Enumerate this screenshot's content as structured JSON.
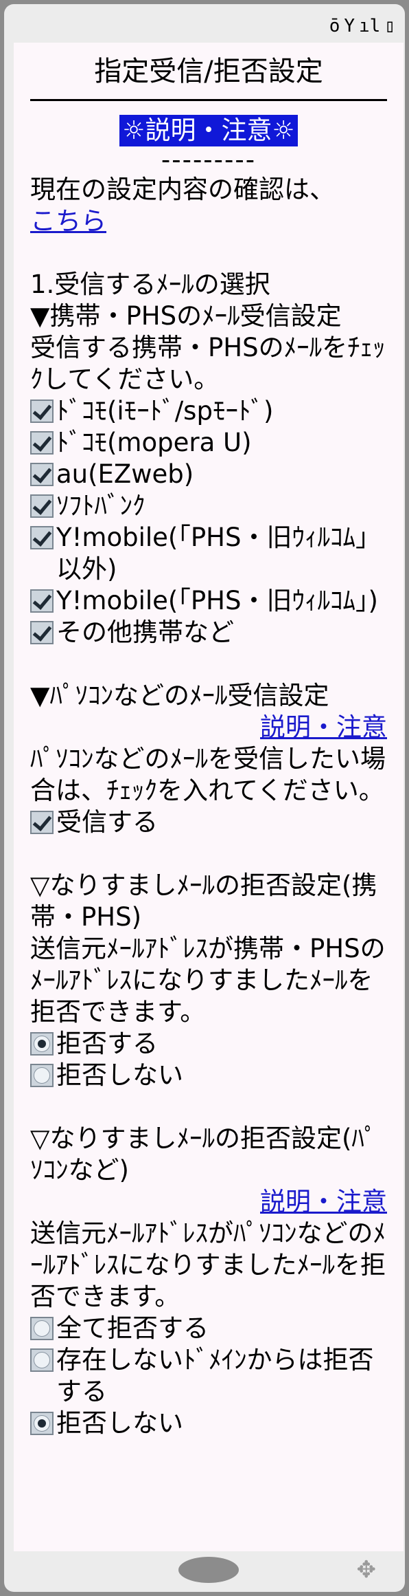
{
  "status": {
    "icons": [
      "sim-icon",
      "antenna-icon",
      "signal-icon",
      "battery-icon"
    ],
    "glyphs": [
      "ō",
      "Y",
      "ıl",
      "▯"
    ]
  },
  "title": "指定受信/拒否設定",
  "banner": "☼説明・注意☼",
  "dashes": "---------",
  "intro": {
    "text": "現在の設定内容の確認は、",
    "link": "こちら"
  },
  "section1": {
    "heading": "1.受信するﾒｰﾙの選択",
    "subheading": "▼携帯・PHSのﾒｰﾙ受信設定",
    "description": "受信する携帯・PHSのﾒｰﾙをﾁｪｯｸしてください。",
    "carriers": [
      {
        "label": "ﾄﾞｺﾓ(iﾓｰﾄﾞ/spﾓｰﾄﾞ)",
        "checked": true
      },
      {
        "label": "ﾄﾞｺﾓ(mopera U)",
        "checked": true
      },
      {
        "label": "au(EZweb)",
        "checked": true
      },
      {
        "label": "ｿﾌﾄﾊﾞﾝｸ",
        "checked": true
      },
      {
        "label": "Y!mobile(「PHS・旧ｳｨﾙｺﾑ」以外)",
        "checked": true
      },
      {
        "label": "Y!mobile(「PHS・旧ｳｨﾙｺﾑ」)",
        "checked": true
      },
      {
        "label": "その他携帯など",
        "checked": true
      }
    ]
  },
  "pc": {
    "heading": "▼ﾊﾟｿｺﾝなどのﾒｰﾙ受信設定",
    "link": "説明・注意",
    "description": "ﾊﾟｿｺﾝなどのﾒｰﾙを受信したい場合は、ﾁｪｯｸを入れてください。",
    "checkbox_label": "受信する"
  },
  "spoof_mobile": {
    "heading": "▽なりすましﾒｰﾙの拒否設定(携帯・PHS)",
    "description": "送信元ﾒｰﾙｱﾄﾞﾚｽが携帯・PHSのﾒｰﾙｱﾄﾞﾚｽになりすましたﾒｰﾙを拒否できます。",
    "options": [
      {
        "label": "拒否する",
        "selected": true
      },
      {
        "label": "拒否しない",
        "selected": false
      }
    ]
  },
  "spoof_pc": {
    "heading": "▽なりすましﾒｰﾙの拒否設定(ﾊﾟｿｺﾝなど)",
    "link": "説明・注意",
    "description": "送信元ﾒｰﾙｱﾄﾞﾚｽがﾊﾟｿｺﾝなどのﾒｰﾙｱﾄﾞﾚｽになりすましたﾒｰﾙを拒否できます。",
    "options": [
      {
        "label": "全て拒否する",
        "selected": false
      },
      {
        "label": "存在しないﾄﾞﾒｲﾝからは拒否する",
        "selected": false
      },
      {
        "label": "拒否しない",
        "selected": true
      }
    ]
  },
  "bottom": {
    "dpad_glyph": "✥"
  }
}
